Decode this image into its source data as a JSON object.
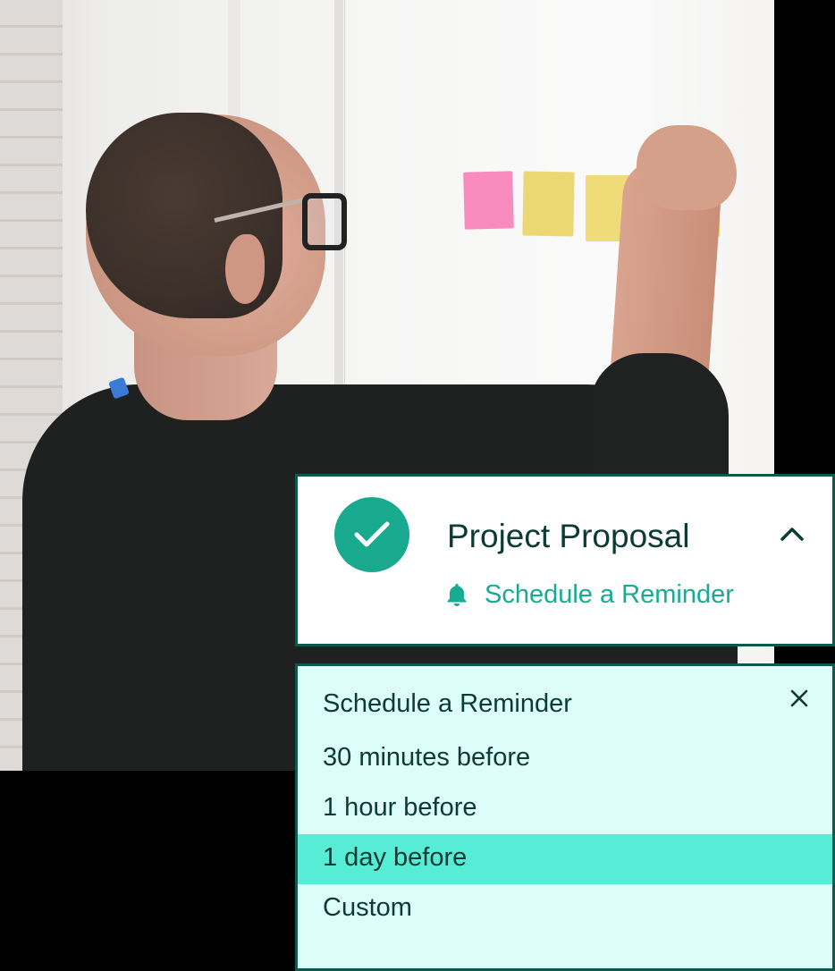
{
  "task": {
    "title": "Project Proposal",
    "completed": true,
    "reminder_link_label": "Schedule a Reminder"
  },
  "reminder_menu": {
    "title": "Schedule a Reminder",
    "options": [
      {
        "label": "30 minutes before",
        "selected": false
      },
      {
        "label": "1 hour before",
        "selected": false
      },
      {
        "label": "1 day before",
        "selected": true
      },
      {
        "label": "Custom",
        "selected": false
      }
    ]
  },
  "icons": {
    "status": "check-circle-icon",
    "collapse": "chevron-up-icon",
    "reminder": "bell-icon",
    "close": "close-icon"
  },
  "colors": {
    "accent": "#17ab92",
    "check_fill": "#19a98f",
    "border": "#0b5a4b",
    "panel_bg": "#dcfdf8",
    "selected_bg": "#56ecd6",
    "text": "#0c3b33"
  }
}
